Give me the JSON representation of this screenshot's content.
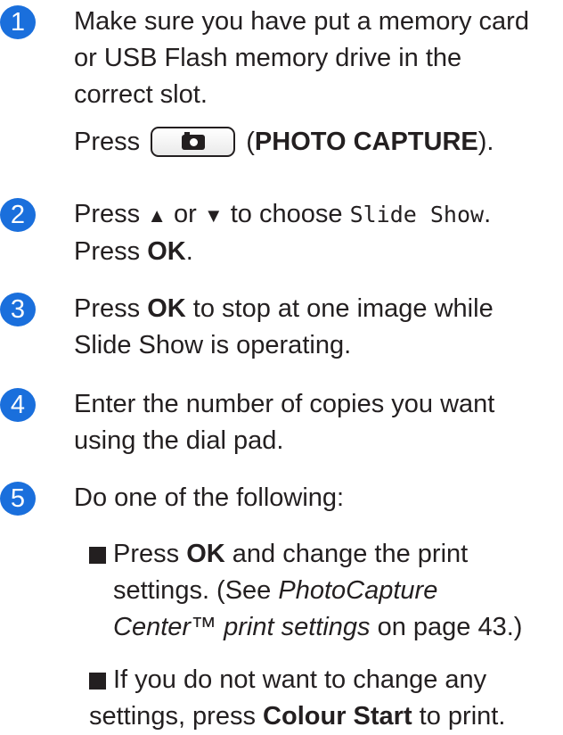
{
  "steps": [
    {
      "number": "1",
      "line1": "Make sure you have put a memory card",
      "line2": "or USB Flash memory drive in the",
      "line3": "correct slot.",
      "press": "Press",
      "button_icon": "camera-icon",
      "button_name": "PHOTO CAPTURE",
      "open_paren": " (",
      "close_paren": ")."
    },
    {
      "number": "2",
      "press": "Press",
      "up_arrow": "▲",
      "or": "or",
      "down_arrow": "▼",
      "to_choose": "to choose",
      "menu_item": "Slide Show",
      "period": ".",
      "press2": "Press",
      "ok": "OK",
      "period2": "."
    },
    {
      "number": "3",
      "press": "Press",
      "ok": "OK",
      "rest1": "to stop at one image while",
      "line2": "Slide Show is operating."
    },
    {
      "number": "4",
      "line1": "Enter the number of copies you want",
      "line2": "using the dial pad."
    },
    {
      "number": "5",
      "line1": "Do one of the following:",
      "bullets": [
        {
          "press": "Press",
          "ok": "OK",
          "rest": "and change the print",
          "line2": "settings. (See",
          "italic": "PhotoCapture",
          "italic2": "Center™ print settings",
          "tail": "on page 43.)"
        },
        {
          "line1": "If you do not want to change any",
          "pre": "settings, press",
          "bold": "Colour Start",
          "post": "to print."
        }
      ]
    }
  ]
}
